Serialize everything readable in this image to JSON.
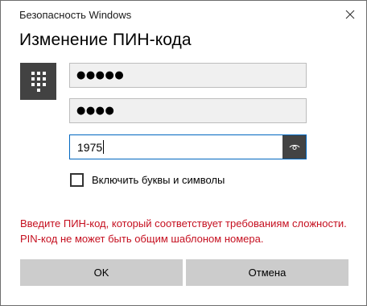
{
  "window": {
    "title": "Безопасность Windows"
  },
  "dialog": {
    "heading": "Изменение ПИН-кода",
    "current_pin_mask": "●●●●●",
    "new_pin_mask": "●●●●",
    "confirm_pin_value": "1975",
    "include_letters_label": "Включить буквы и символы",
    "include_letters_checked": false,
    "error_message": "Введите ПИН-код, который соответствует требованиям сложности. PIN-код не может быть общим шаблоном номера.",
    "error_color": "#c50f1f",
    "ok_label": "OK",
    "cancel_label": "Отмена"
  },
  "icons": {
    "close": "close-icon",
    "pin_tile": "keypad-icon",
    "reveal": "eye-icon"
  },
  "colors": {
    "accent": "#0067c0",
    "tile": "#424242",
    "button": "#cccccc"
  }
}
